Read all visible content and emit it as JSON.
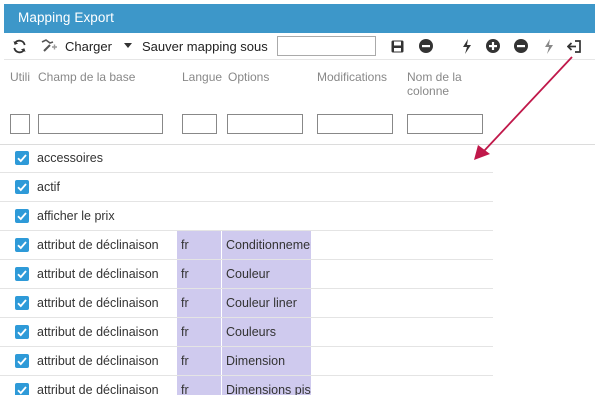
{
  "window": {
    "title": "Mapping Export"
  },
  "toolbar": {
    "load_label": "Charger",
    "save_mapping_label": "Sauver mapping sous",
    "mapping_name_value": ""
  },
  "columns": {
    "use": "Utili",
    "field": "Champ de la base",
    "lang": "Langue",
    "options": "Options",
    "modifications": "Modifications",
    "colname_line1": "Nom de la",
    "colname_line2": "colonne"
  },
  "filters": {
    "use": "",
    "field": "",
    "lang": "",
    "options": "",
    "modifications": "",
    "colname": ""
  },
  "rows": [
    {
      "checked": true,
      "field": "accessoires",
      "lang": "",
      "option": ""
    },
    {
      "checked": true,
      "field": "actif",
      "lang": "",
      "option": ""
    },
    {
      "checked": true,
      "field": "afficher le prix",
      "lang": "",
      "option": ""
    },
    {
      "checked": true,
      "field": "attribut de déclinaison",
      "lang": "fr",
      "option": "Conditionnement"
    },
    {
      "checked": true,
      "field": "attribut de déclinaison",
      "lang": "fr",
      "option": "Couleur"
    },
    {
      "checked": true,
      "field": "attribut de déclinaison",
      "lang": "fr",
      "option": "Couleur liner"
    },
    {
      "checked": true,
      "field": "attribut de déclinaison",
      "lang": "fr",
      "option": "Couleurs"
    },
    {
      "checked": true,
      "field": "attribut de déclinaison",
      "lang": "fr",
      "option": "Dimension"
    },
    {
      "checked": true,
      "field": "attribut de déclinaison",
      "lang": "fr",
      "option": "Dimensions pis"
    }
  ],
  "colors": {
    "titlebar": "#3d97c9",
    "checkbox": "#2e9ad8",
    "highlight": "#cfcaee",
    "arrow": "#c0184a"
  },
  "icons": [
    "refresh-icon",
    "wand-icon",
    "caret-down-icon",
    "save-icon",
    "remove-icon",
    "lightning-icon",
    "add-icon",
    "remove-icon",
    "lightning-off-icon",
    "sign-in-icon"
  ]
}
